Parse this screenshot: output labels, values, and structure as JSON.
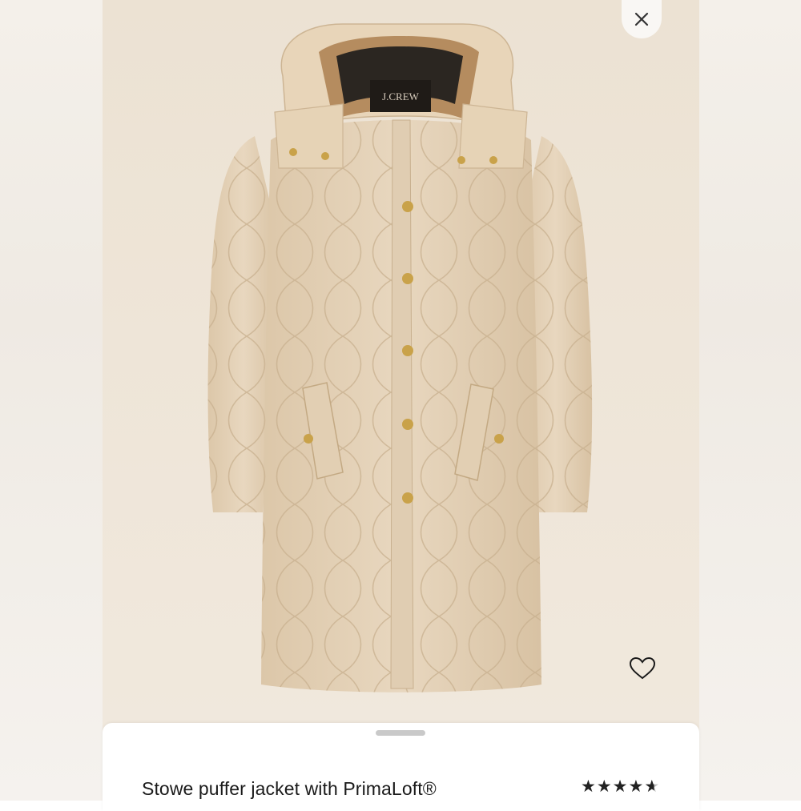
{
  "product": {
    "title": "Stowe puffer jacket with PrimaLoft®",
    "brand_label": "J.CREW",
    "rating_value": 4.7,
    "rating_max": 5
  },
  "icons": {
    "close": "close-icon",
    "favorite": "heart-outline-icon",
    "star": "star-icon"
  },
  "colors": {
    "background": "#eee4d6",
    "coat": "#e4d2b8",
    "collar": "#b58c5f",
    "buttons": "#c9a24a"
  }
}
